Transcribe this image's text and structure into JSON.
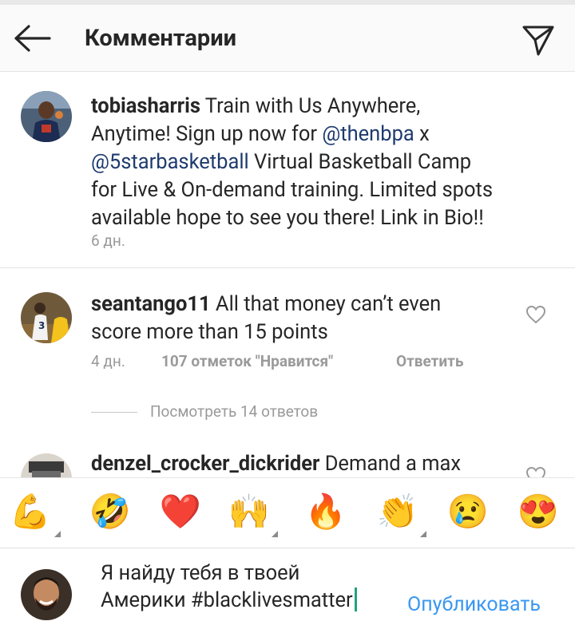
{
  "header": {
    "title": "Комментарии",
    "back_icon": "arrow-left-icon",
    "send_icon": "paper-plane-icon"
  },
  "caption": {
    "username": "tobiasharris",
    "line1_text": " Train with Us Anywhere,",
    "line2_text": "Anytime! Sign up now for ",
    "mention1": "@thenbpa",
    "line2_tail": " x",
    "mention2": "@5starbasketball",
    "line3_tail": " Virtual Basketball Camp",
    "line4": "for Live & On-demand training. Limited spots",
    "line5": "available hope to see you there!  Link in Bio!!",
    "time": "6 дн."
  },
  "comments": [
    {
      "username": "seantango11",
      "text_line1": " All that money can’t even",
      "text_line2": "score more than 15 points",
      "time": "4 дн.",
      "likes": "107 отметок \"Нравится\"",
      "reply": "Ответить"
    },
    {
      "username": "denzel_crocker_dickrider",
      "text_line1": " Demand a max"
    }
  ],
  "replies_toggle": "Посмотреть 14 ответов",
  "emoji_bar": [
    "💪",
    "🤣",
    "❤️",
    "🙌",
    "🔥",
    "👏",
    "😢",
    "😍"
  ],
  "composer": {
    "line1": "Я найду тебя в твоей",
    "line2": "Америки #blacklivesmatter",
    "publish": "Опубликовать"
  },
  "colors": {
    "mention": "#1e3b6e",
    "publish": "#3897f0",
    "muted": "#9a9a9a",
    "cursor": "#1fa37a"
  }
}
